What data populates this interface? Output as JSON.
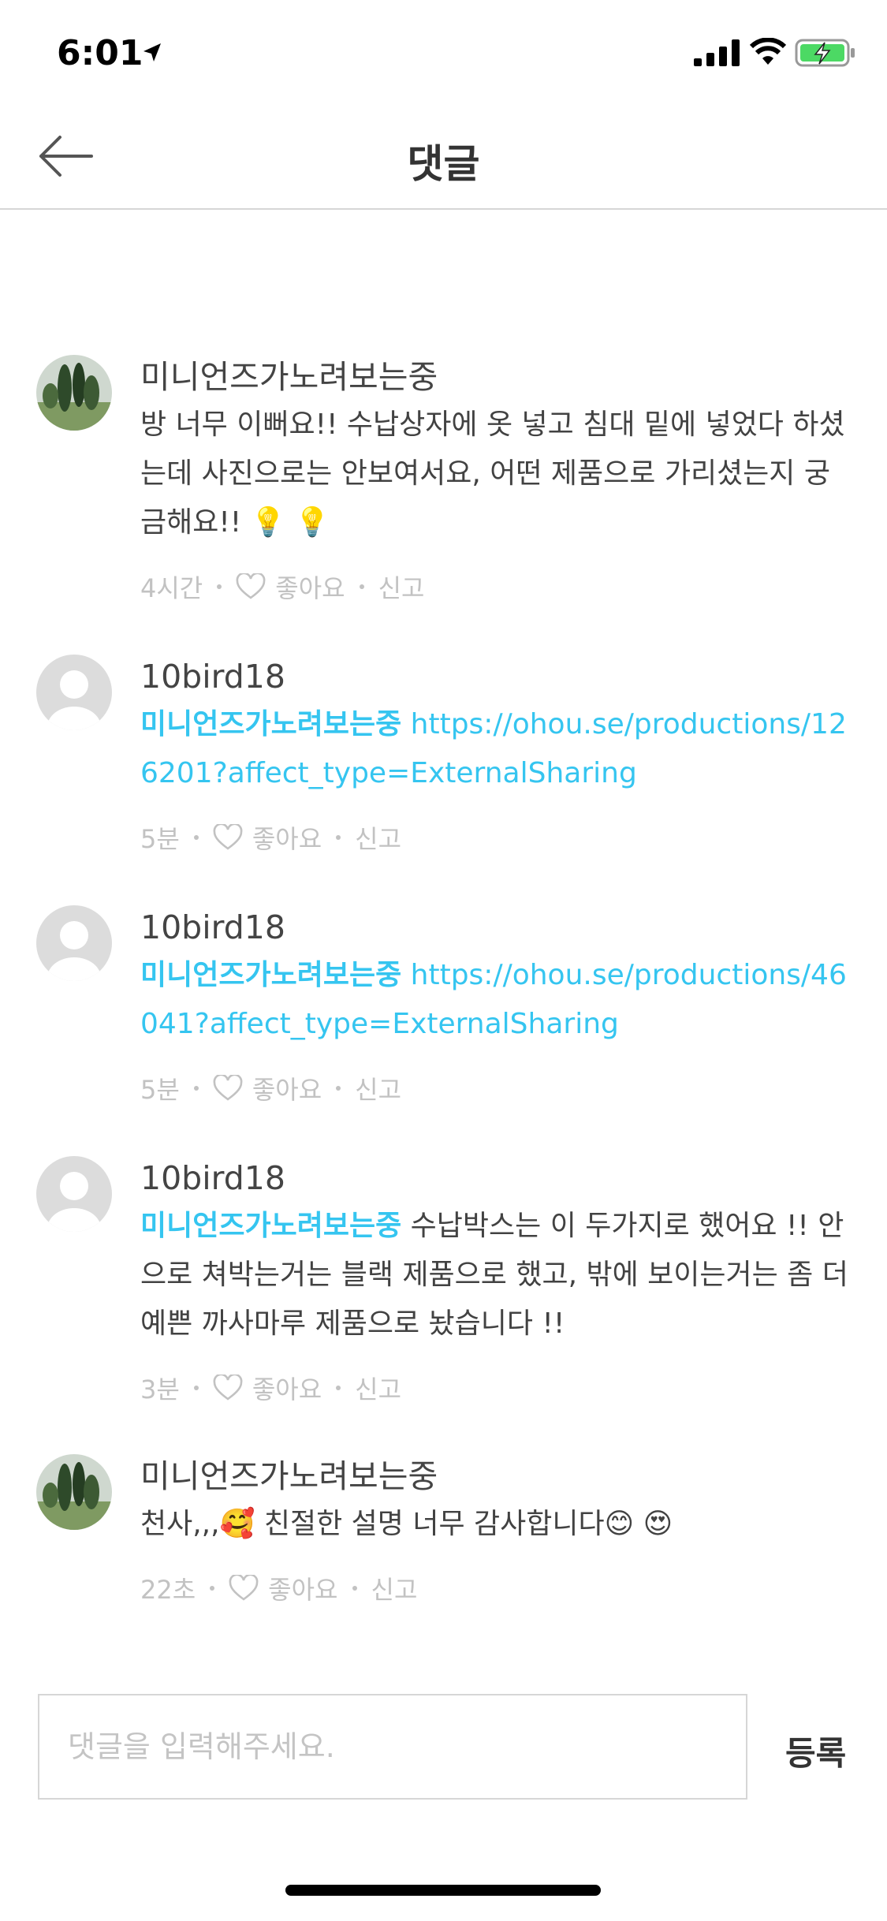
{
  "status_bar": {
    "time": "6:01"
  },
  "header": {
    "title": "댓글"
  },
  "comments": [
    {
      "author": "미니언즈가노려보는중",
      "avatar": "tree-photo",
      "mention": "",
      "text": "방 너무 이뻐요!! 수납상자에 옷 넣고 침대 밑에 넣었다 하셨는데 사진으로는 안보여서요, 어떤 제품으로 가리셨는지 궁금해요!! 💡 💡",
      "link": "",
      "time": "4시간",
      "like_label": "좋아요",
      "report_label": "신고"
    },
    {
      "author": "10bird18",
      "avatar": "default-profile",
      "mention": "미니언즈가노려보는중",
      "text": "",
      "link": "https://ohou.se/productions/126201?affect_type=ExternalSharing",
      "time": "5분",
      "like_label": "좋아요",
      "report_label": "신고"
    },
    {
      "author": "10bird18",
      "avatar": "default-profile",
      "mention": "미니언즈가노려보는중",
      "text": "",
      "link": "https://ohou.se/productions/46041?affect_type=ExternalSharing",
      "time": "5분",
      "like_label": "좋아요",
      "report_label": "신고"
    },
    {
      "author": "10bird18",
      "avatar": "default-profile",
      "mention": "미니언즈가노려보는중",
      "text": "수납박스는 이 두가지로 했어요 !! 안으로 쳐박는거는 블랙 제품으로 했고, 밖에 보이는거는 좀 더 예쁜 까사마루 제품으로 놨습니다 !!",
      "link": "",
      "time": "3분",
      "like_label": "좋아요",
      "report_label": "신고"
    },
    {
      "author": "미니언즈가노려보는중",
      "avatar": "tree-photo",
      "mention": "",
      "text": "천사,,,🥰 친절한 설명 너무 감사합니다😊 😍",
      "link": "",
      "time": "22초",
      "like_label": "좋아요",
      "report_label": "신고"
    }
  ],
  "input": {
    "placeholder": "댓글을 입력해주세요.",
    "value": "",
    "submit_label": "등록"
  },
  "colors": {
    "accent": "#35c5f0",
    "meta": "#c2c2c2",
    "border": "#d6d6d6"
  }
}
